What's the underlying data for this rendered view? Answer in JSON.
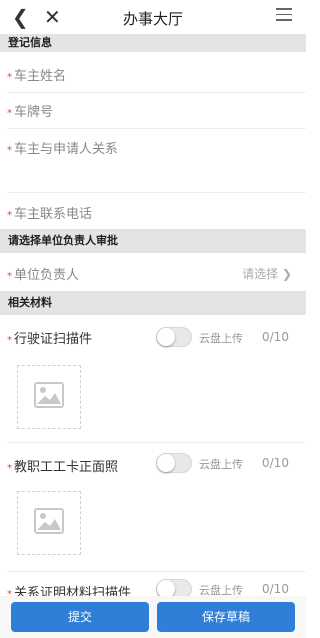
{
  "header": {
    "back_icon": "chevron-left-icon",
    "close_icon": "close-icon",
    "title": "办事大厅",
    "menu_icon": "hamburger-menu-icon"
  },
  "sections": {
    "registration": "登记信息",
    "approval": "请选择单位负责人审批",
    "materials": "相关材料"
  },
  "fields": {
    "owner_name": "车主姓名",
    "plate_number": "车牌号",
    "relationship": "车主与申请人关系",
    "owner_phone": "车主联系电话",
    "unit_head": "单位负责人",
    "unit_head_placeholder": "请选择",
    "required_mark": "*"
  },
  "materials": [
    {
      "label": "行驶证扫描件",
      "cloud_label": "云盘上传",
      "count": "0/10"
    },
    {
      "label": "教职工工卡正面照",
      "cloud_label": "云盘上传",
      "count": "0/10"
    },
    {
      "label": "关系证明材料扫描件",
      "cloud_label": "云盘上传",
      "count": "0/10"
    }
  ],
  "footer": {
    "submit": "提交",
    "save_draft": "保存草稿"
  },
  "colors": {
    "accent": "#2f7fd8",
    "required": "#e64340",
    "section_bg": "#e4e4e4"
  }
}
